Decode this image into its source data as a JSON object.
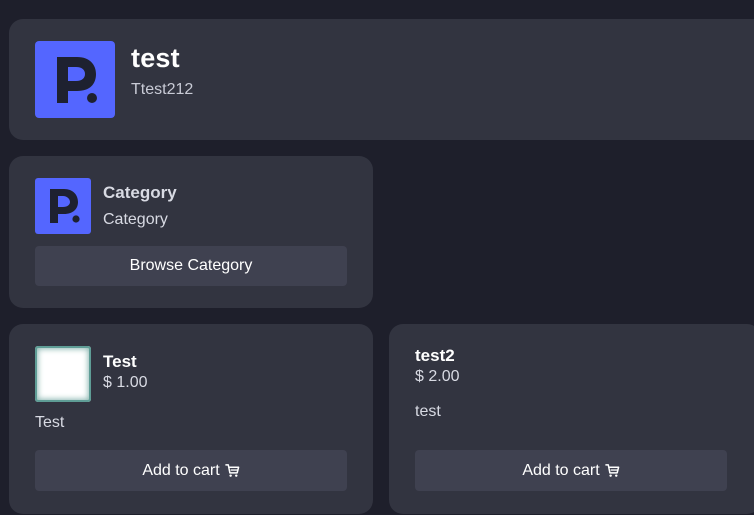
{
  "header": {
    "title": "test",
    "subtitle": "Ttest212",
    "logo_icon": "p-logo-icon"
  },
  "category": {
    "title": "Category",
    "subtitle": "Category",
    "browse_label": "Browse Category",
    "logo_icon": "p-logo-icon"
  },
  "products": [
    {
      "name": "Test",
      "price": "$ 1.00",
      "description": "Test",
      "add_label": "Add to cart",
      "cart_icon": "cart-icon"
    },
    {
      "name": "test2",
      "price": "$ 2.00",
      "description": "test",
      "add_label": "Add to cart",
      "cart_icon": "cart-icon"
    }
  ],
  "colors": {
    "background": "#1e1f2b",
    "card": "#323440",
    "button": "#3f4150",
    "brand": "#5466ff"
  }
}
